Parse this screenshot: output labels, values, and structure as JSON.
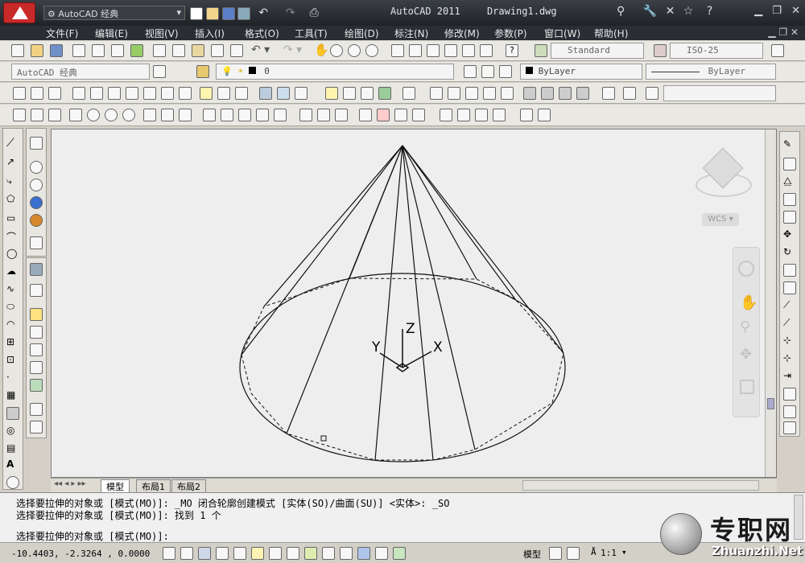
{
  "title": {
    "workspace_combo": "AutoCAD 经典",
    "app_name": "AutoCAD 2011",
    "document": "Drawing1.dwg"
  },
  "menu": [
    "文件(F)",
    "编辑(E)",
    "视图(V)",
    "插入(I)",
    "格式(O)",
    "工具(T)",
    "绘图(D)",
    "标注(N)",
    "修改(M)",
    "参数(P)",
    "窗口(W)",
    "帮助(H)"
  ],
  "styles": {
    "text_style": "Standard",
    "dim_style": "ISO-25"
  },
  "layers": {
    "workspace": "AutoCAD 经典",
    "current_layer": "0",
    "color": "ByLayer",
    "linetype": "ByLayer"
  },
  "viewcube": {
    "wcs": "WCS"
  },
  "ucs": {
    "x": "X",
    "y": "Y",
    "z": "Z"
  },
  "layout_tabs": [
    "模型",
    "布局1",
    "布局2"
  ],
  "command": {
    "line1": "选择要拉伸的对象或 [模式(MO)]: _MO 闭合轮廓创建模式 [实体(SO)/曲面(SU)] <实体>: _SO",
    "line2": "选择要拉伸的对象或 [模式(MO)]: 找到 1 个",
    "line3": "选择要拉伸的对象或 [模式(MO)]:"
  },
  "status": {
    "coordinates": "-10.4403, -2.3264 , 0.0000",
    "model_label": "模型",
    "scale": "1:1"
  },
  "watermark": {
    "brand": "专职网",
    "url": "Zhuanzhi.Net"
  },
  "colors": {
    "titlebar": "#1f2227",
    "drawing_bg": "#eeeeee",
    "accent_red": "#cc2020"
  }
}
